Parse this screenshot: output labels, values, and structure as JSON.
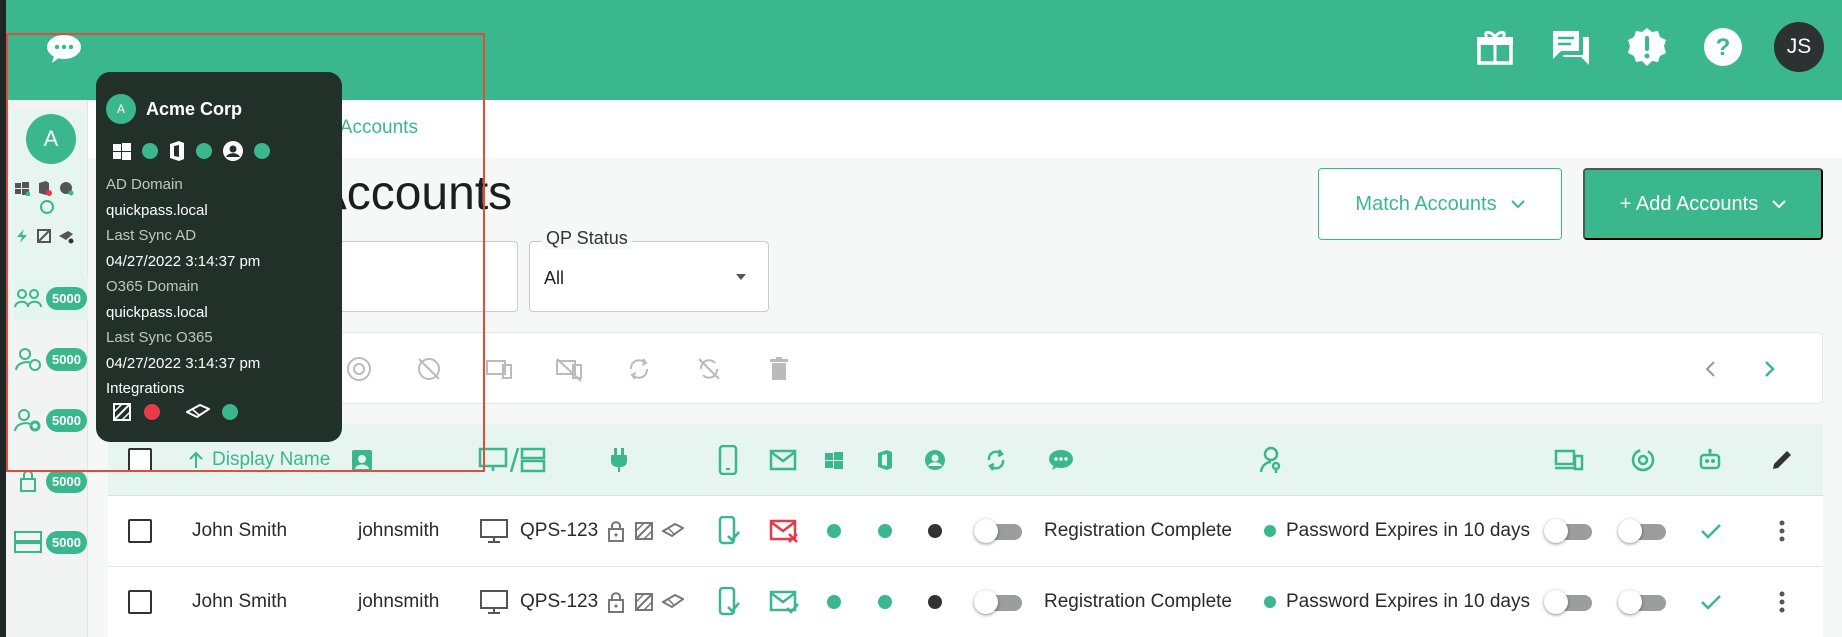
{
  "colors": {
    "brand": "#3bb78d",
    "danger": "#e83a4b",
    "dark": "#22302a"
  },
  "header": {
    "chat_icon": "chat-bubble-icon",
    "icons": [
      "gift-icon",
      "messages-icon",
      "alert-badge-icon",
      "help-icon"
    ],
    "avatar_initials": "JS"
  },
  "sidebar": {
    "org_initial": "A",
    "items": [
      {
        "icon": "users-group-icon",
        "count": "5000"
      },
      {
        "icon": "user-clock-icon",
        "count": "5000"
      },
      {
        "icon": "user-gear-icon",
        "count": "5000"
      },
      {
        "icon": "lock-icon",
        "count": "5000"
      },
      {
        "icon": "server-icon",
        "count": "5000"
      }
    ]
  },
  "breadcrumb": "nd-User Accounts",
  "page": {
    "title": "d-User Accounts",
    "match_button": "Match Accounts",
    "add_button": "+ Add Accounts"
  },
  "filters": {
    "qp_status_label": "QP Status",
    "qp_status_value": "All"
  },
  "toolbar": {
    "first_label": "e"
  },
  "table": {
    "header": {
      "display_name": "Display Name"
    },
    "rows": [
      {
        "display_name": "John Smith",
        "username": "johnsmith",
        "device": "QPS-123",
        "email_status": "error",
        "registration": "Registration Complete",
        "password": "Password Expires in 10 days"
      },
      {
        "display_name": "John Smith",
        "username": "johnsmith",
        "device": "QPS-123",
        "email_status": "ok",
        "registration": "Registration Complete",
        "password": "Password Expires in 10 days"
      }
    ]
  },
  "tooltip": {
    "initial": "A",
    "org_name": "Acme Corp",
    "ad_domain_label": "AD Domain",
    "ad_domain_value": "quickpass.local",
    "last_sync_ad_label": "Last Sync AD",
    "last_sync_ad_value": "04/27/2022 3:14:37 pm",
    "o365_domain_label": "O365 Domain",
    "o365_domain_value": "quickpass.local",
    "last_sync_o365_label": "Last Sync O365",
    "last_sync_o365_value": "04/27/2022 3:14:37 pm",
    "integrations_label": "Integrations"
  }
}
